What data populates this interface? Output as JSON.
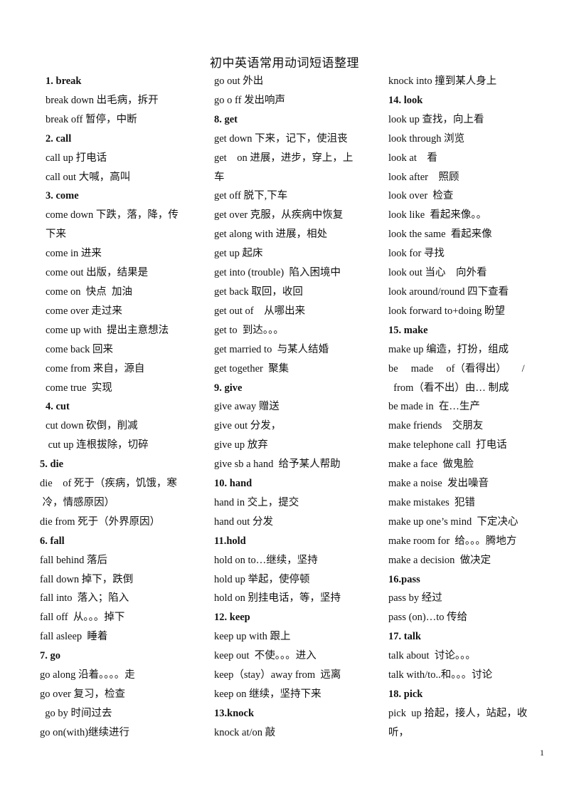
{
  "title": "初中英语常用动词短语整理",
  "page_number": "1",
  "columns": [
    [
      {
        "t": "1. break",
        "h": true,
        "i": true
      },
      {
        "t": "break down 出毛病，拆开",
        "i": true
      },
      {
        "t": "break off 暂停，中断",
        "i": true
      },
      {
        "t": "2. call",
        "h": true,
        "i": true
      },
      {
        "t": "call up 打电话",
        "i": true
      },
      {
        "t": "call out 大喊，高叫",
        "i": true
      },
      {
        "t": "3. come",
        "h": true,
        "i": true
      },
      {
        "t": "come down 下跌，落，降，传",
        "i": true
      },
      {
        "t": "下来",
        "i": true
      },
      {
        "t": "come in 进来",
        "i": true
      },
      {
        "t": "come out 出版，结果是",
        "i": true
      },
      {
        "t": "come on  快点  加油",
        "i": true
      },
      {
        "t": "come over 走过来",
        "i": true
      },
      {
        "t": "come up with  提出主意想法",
        "i": true
      },
      {
        "t": "come back 回来",
        "i": true
      },
      {
        "t": "come from 来自，源自",
        "i": true
      },
      {
        "t": "come true  实现",
        "i": true
      },
      {
        "t": "4. cut",
        "h": true,
        "i": true
      },
      {
        "t": "cut down 砍倒，削减",
        "i": true
      },
      {
        "t": " cut up 连根拔除，切碎",
        "i": true
      },
      {
        "t": "5. die",
        "h": true
      },
      {
        "t": "die    of 死于（疾病，饥饿，寒"
      },
      {
        "t": " 冷，情感原因）"
      },
      {
        "t": "die from 死于（外界原因）"
      },
      {
        "t": "6. fall",
        "h": true
      },
      {
        "t": "fall behind 落后"
      },
      {
        "t": "fall down 掉下，跌倒"
      },
      {
        "t": "fall into  落入；陷入"
      },
      {
        "t": "fall off  从。。。掉下"
      },
      {
        "t": "fall asleep  睡着"
      },
      {
        "t": "7. go",
        "h": true
      },
      {
        "t": "go along 沿着。。。。走"
      },
      {
        "t": "go over 复习，检查"
      },
      {
        "t": "  go by 时间过去"
      },
      {
        "t": "go on(with)继续进行"
      }
    ],
    [
      {
        "t": "go out 外出"
      },
      {
        "t": "go o ff 发出响声"
      },
      {
        "t": "8. get",
        "h": true
      },
      {
        "t": "get down 下来，记下，使沮丧"
      },
      {
        "t": "get    on 进展，进步，穿上，上"
      },
      {
        "t": "车"
      },
      {
        "t": "get off 脱下,下车"
      },
      {
        "t": "get over 克服，从疾病中恢复"
      },
      {
        "t": "get along with 进展，相处"
      },
      {
        "t": "get up 起床"
      },
      {
        "t": "get into (trouble)  陷入困境中"
      },
      {
        "t": "get back 取回，收回"
      },
      {
        "t": "get out of    从哪出来"
      },
      {
        "t": "get to  到达。。。"
      },
      {
        "t": "get married to  与某人结婚"
      },
      {
        "t": "get together  聚集"
      },
      {
        "t": "9. give",
        "h": true
      },
      {
        "t": "give away 赠送"
      },
      {
        "t": "give out 分发，"
      },
      {
        "t": "give up 放弃"
      },
      {
        "t": "give sb a hand  给予某人帮助"
      },
      {
        "t": "10. hand",
        "h": true
      },
      {
        "t": "hand in 交上，提交"
      },
      {
        "t": "hand out 分发"
      },
      {
        "t": "11.hold",
        "h": true
      },
      {
        "t": "hold on to…继续，坚持"
      },
      {
        "t": "hold up 举起，使停顿"
      },
      {
        "t": "hold on 别挂电话，等，坚持"
      },
      {
        "t": "12. keep",
        "h": true
      },
      {
        "t": "keep up with 跟上"
      },
      {
        "t": "keep out  不使。。。进入"
      },
      {
        "t": "keep（stay）away from  远离"
      },
      {
        "t": "keep on 继续，坚持下来"
      },
      {
        "t": "13.knock",
        "h": true
      },
      {
        "t": "knock at/on 敲"
      }
    ],
    [
      {
        "t": "knock into 撞到某人身上"
      },
      {
        "t": "14. look",
        "h": true
      },
      {
        "t": "look up 查找，向上看"
      },
      {
        "t": "look through 浏览"
      },
      {
        "t": "look at    看"
      },
      {
        "t": "look after    照顾"
      },
      {
        "t": "look over  检查"
      },
      {
        "t": "look like  看起来像。。"
      },
      {
        "t": "look the same  看起来像"
      },
      {
        "t": "look for 寻找"
      },
      {
        "t": "look out 当心    向外看"
      },
      {
        "t": "look around/round 四下查看"
      },
      {
        "t": "look forward to+doing 盼望"
      },
      {
        "t": "15. make",
        "h": true
      },
      {
        "t": "make up 编造，打扮，组成"
      },
      {
        "t": "be     made     of（看得出）      /"
      },
      {
        "t": "  from（看不出）由… 制成"
      },
      {
        "t": "be made in  在…生产"
      },
      {
        "t": "make friends    交朋友"
      },
      {
        "t": "make telephone call  打电话"
      },
      {
        "t": "make a face  做鬼脸"
      },
      {
        "t": "make a noise  发出噪音"
      },
      {
        "t": "make mistakes  犯错"
      },
      {
        "t": "make up one’s mind  下定决心"
      },
      {
        "t": "make room for  给。。。腾地方"
      },
      {
        "t": "make a decision  做决定"
      },
      {
        "t": "16.pass",
        "h": true
      },
      {
        "t": "pass by 经过"
      },
      {
        "t": "pass (on)…to 传给"
      },
      {
        "t": "17. talk",
        "h": true
      },
      {
        "t": "talk about  讨论。。。"
      },
      {
        "t": "talk with/to..和。。。讨论"
      },
      {
        "t": "18. pick",
        "h": true
      },
      {
        "t": "pick  up 拾起，接人，站起，收"
      },
      {
        "t": "听，"
      }
    ]
  ]
}
